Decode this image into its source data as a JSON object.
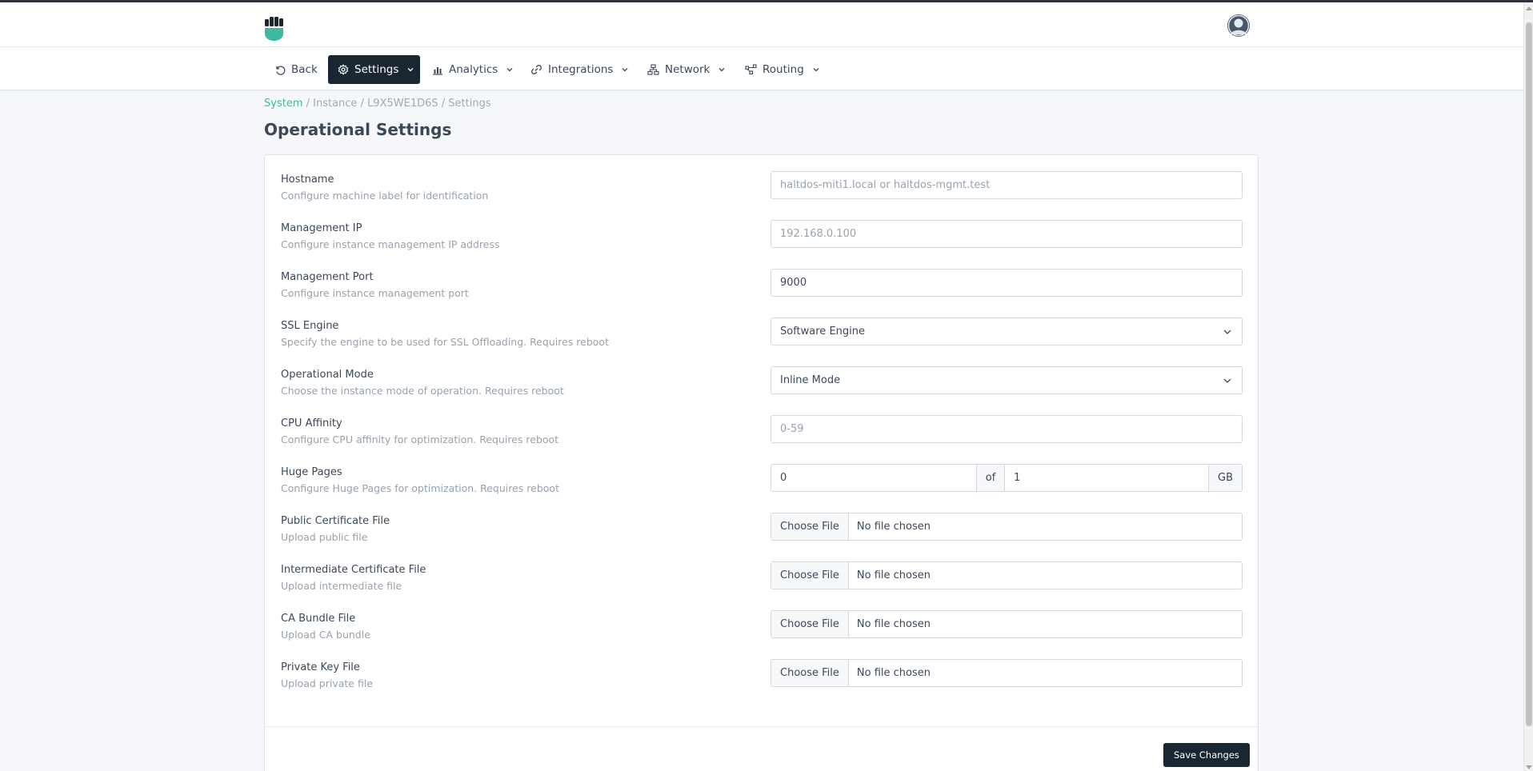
{
  "colors": {
    "accent": "#3fb8a0",
    "dark": "#1a2733",
    "text": "#3c4858",
    "muted": "#98a2ad",
    "page_bg": "#f5f7fa"
  },
  "header": {
    "logo_icon": "fist-logo-icon",
    "avatar_icon": "user-avatar-icon"
  },
  "nav": {
    "back": "Back",
    "settings": "Settings",
    "analytics": "Analytics",
    "integrations": "Integrations",
    "network": "Network",
    "routing": "Routing"
  },
  "breadcrumb": {
    "system": "System",
    "rest": " / Instance / L9X5WE1D6S / Settings"
  },
  "page_title": "Operational Settings",
  "form": {
    "hostname": {
      "label": "Hostname",
      "desc": "Configure machine label for identification",
      "placeholder": "haltdos-miti1.local or haltdos-mgmt.test"
    },
    "mgmt_ip": {
      "label": "Management IP",
      "desc": "Configure instance management IP address",
      "placeholder": "192.168.0.100"
    },
    "mgmt_port": {
      "label": "Management Port",
      "desc": "Configure instance management port",
      "value": "9000"
    },
    "ssl_engine": {
      "label": "SSL Engine",
      "desc": "Specify the engine to be used for SSL Offloading. Requires reboot",
      "value": "Software Engine"
    },
    "op_mode": {
      "label": "Operational Mode",
      "desc": "Choose the instance mode of operation. Requires reboot",
      "value": "Inline Mode"
    },
    "cpu_affinity": {
      "label": "CPU Affinity",
      "desc": "Configure CPU affinity for optimization. Requires reboot",
      "placeholder": "0-59"
    },
    "huge_pages": {
      "label": "Huge Pages",
      "desc": "Configure Huge Pages for optimization. Requires reboot",
      "value": "0",
      "of": "of",
      "total": "1",
      "unit": "GB"
    },
    "public_cert": {
      "label": "Public Certificate File",
      "desc": "Upload public file",
      "button": "Choose File",
      "status": "No file chosen"
    },
    "intermediate_cert": {
      "label": "Intermediate Certificate File",
      "desc": "Upload intermediate file",
      "button": "Choose File",
      "status": "No file chosen"
    },
    "ca_bundle": {
      "label": "CA Bundle File",
      "desc": "Upload CA bundle",
      "button": "Choose File",
      "status": "No file chosen"
    },
    "private_key": {
      "label": "Private Key File",
      "desc": "Upload private file",
      "button": "Choose File",
      "status": "No file chosen"
    }
  },
  "save_label": "Save Changes"
}
